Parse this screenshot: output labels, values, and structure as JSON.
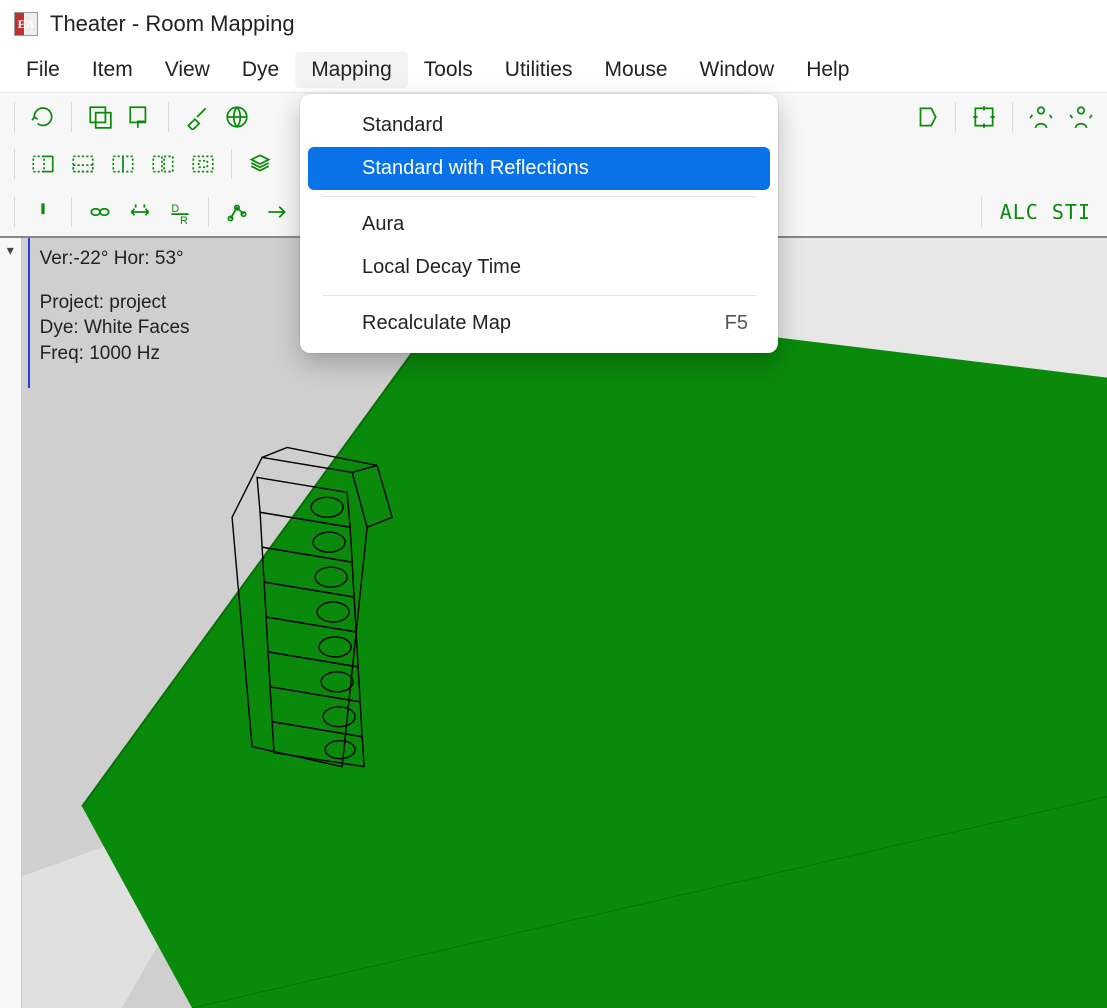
{
  "title": "Theater - Room Mapping",
  "menu": {
    "items": [
      "File",
      "Item",
      "View",
      "Dye",
      "Mapping",
      "Tools",
      "Utilities",
      "Mouse",
      "Window",
      "Help"
    ],
    "open_index": 4
  },
  "mapping_menu": {
    "items": [
      {
        "label": "Standard"
      },
      {
        "label": "Standard with Reflections",
        "highlight": true
      },
      {
        "sep": true
      },
      {
        "label": "Aura"
      },
      {
        "label": "Local Decay Time"
      },
      {
        "sep": true
      },
      {
        "label": "Recalculate Map",
        "shortcut": "F5"
      }
    ]
  },
  "toolbar_row1": {
    "icons": [
      "refresh",
      "doc-a",
      "doc-b",
      "brush",
      "globe",
      "box-move",
      "target",
      "person-a",
      "person-b"
    ],
    "alc_sti": "ALC STI"
  },
  "toolbar_row2": {
    "icons": [
      "grid-right",
      "grid-down",
      "grid-split",
      "grid-dual",
      "grid-center",
      "stack"
    ]
  },
  "toolbar_row3": {
    "icons": [
      "excl",
      "link",
      "width",
      "d-r",
      "branch",
      "arrow-right"
    ]
  },
  "overlay": {
    "angles": "Ver:-22°  Hor: 53°",
    "project": "Project: project",
    "dye": "Dye: White Faces",
    "freq": "Freq: 1000 Hz"
  },
  "colors": {
    "green": "#0a8a0a",
    "floor": "#0a8a0a",
    "room_bg": "#cfcfcf",
    "wall_light": "#e7e7e7"
  }
}
